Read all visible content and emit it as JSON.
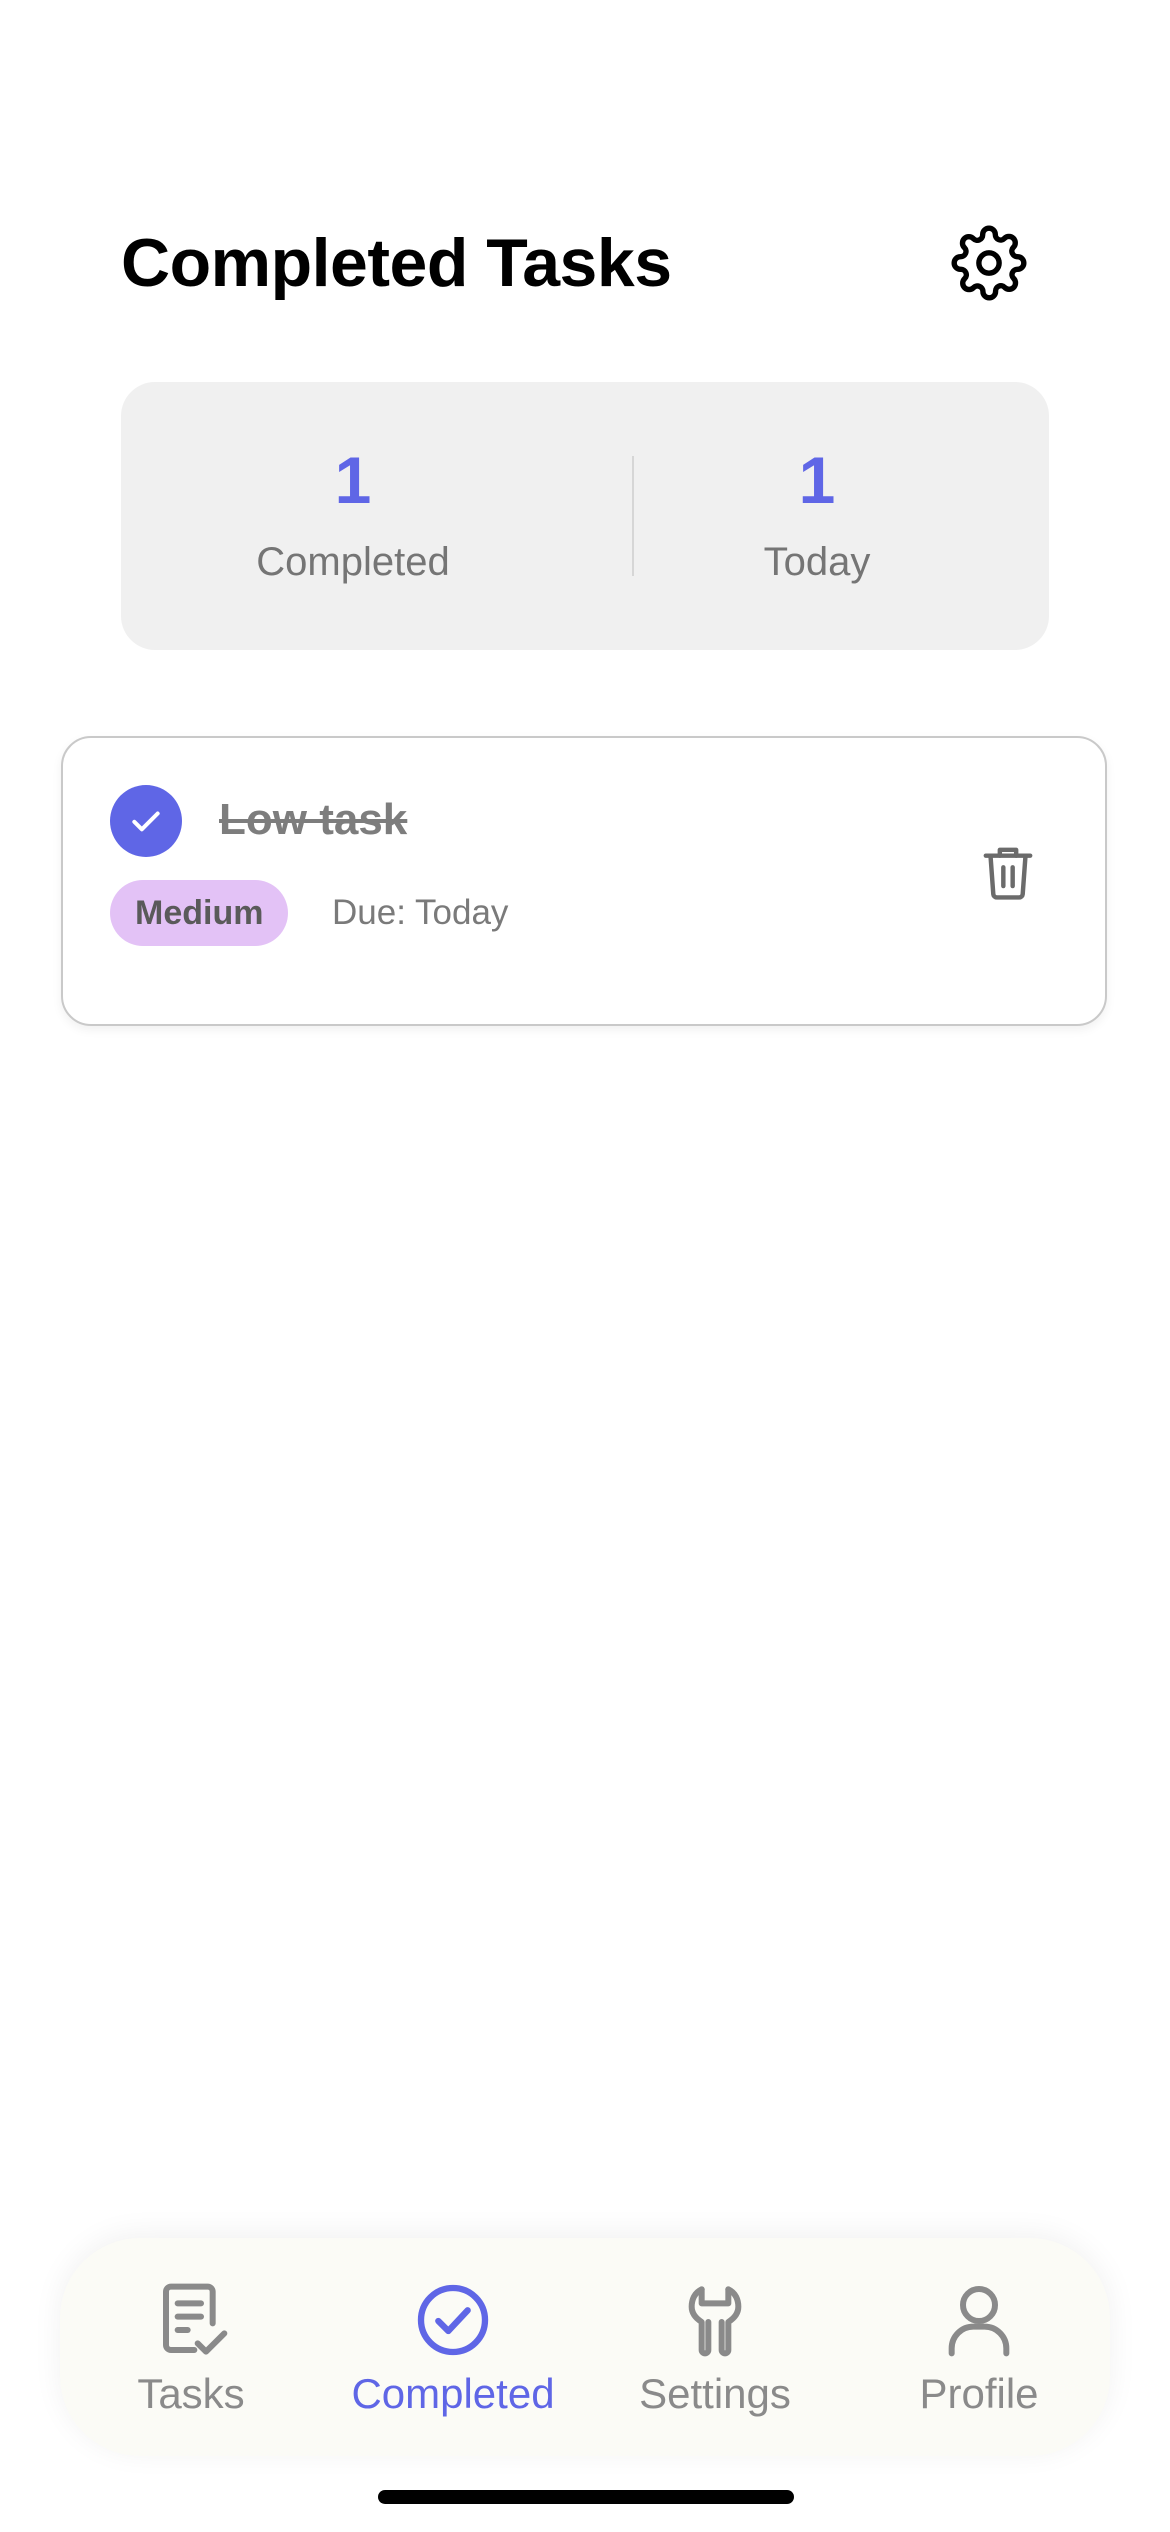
{
  "header": {
    "title": "Completed Tasks",
    "settings_icon": "gear-icon"
  },
  "stats": [
    {
      "value": "1",
      "label": "Completed"
    },
    {
      "value": "1",
      "label": "Today"
    }
  ],
  "tasks": [
    {
      "title": "Low task",
      "completed": true,
      "priority": "Medium",
      "due": "Due: Today",
      "delete_icon": "trash-icon"
    }
  ],
  "tab_bar": {
    "tabs": [
      {
        "label": "Tasks",
        "icon": "tasks-icon",
        "active": false
      },
      {
        "label": "Completed",
        "icon": "check-circle-icon",
        "active": true
      },
      {
        "label": "Settings",
        "icon": "wrench-icon",
        "active": false
      },
      {
        "label": "Profile",
        "icon": "person-icon",
        "active": false
      }
    ]
  },
  "colors": {
    "accent": "#5F66E6",
    "priority_badge": "#E3C2F6",
    "stats_background": "#F0F0F0",
    "tab_bar_background": "#FBFBF6"
  }
}
